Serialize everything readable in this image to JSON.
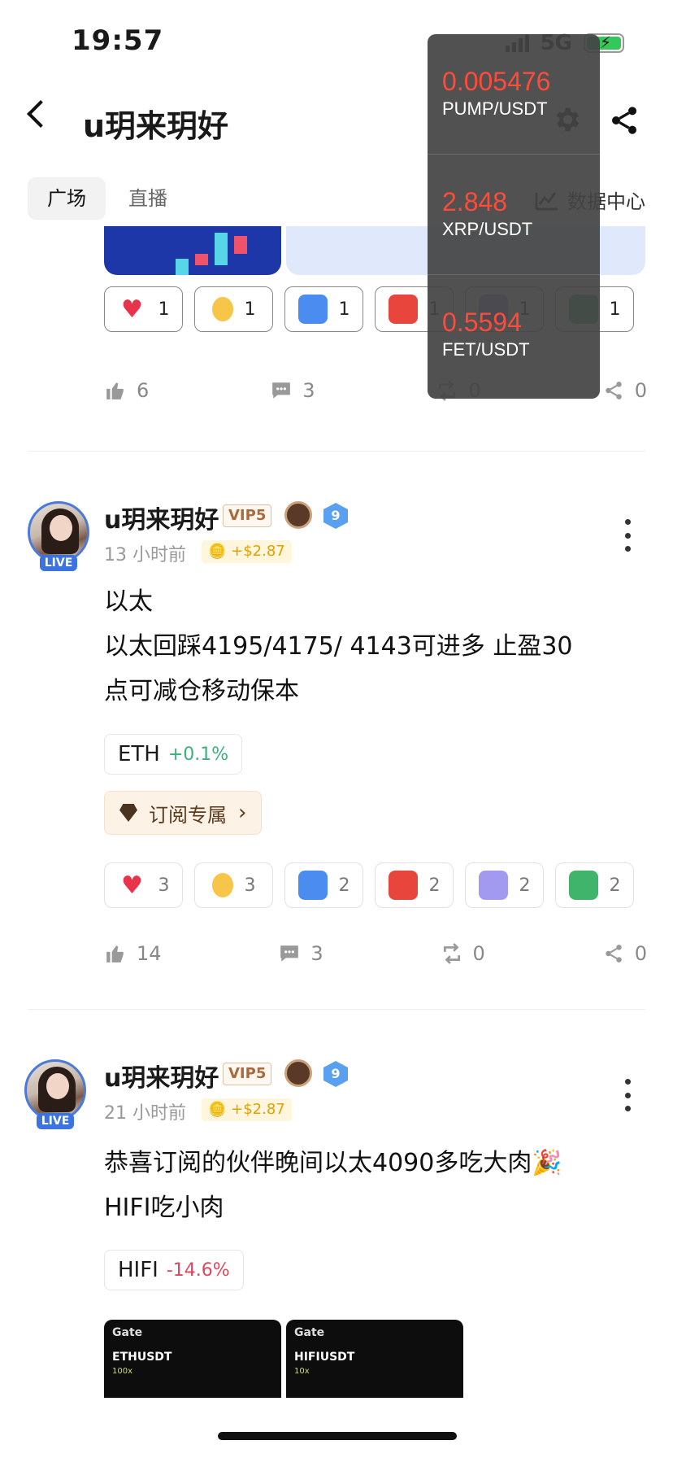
{
  "status_bar": {
    "time": "19:57",
    "network": "5G"
  },
  "header": {
    "title": "u玥来玥好"
  },
  "tabs": [
    {
      "label": "广场"
    },
    {
      "label": "直播"
    }
  ],
  "data_center": {
    "label": "数据中心"
  },
  "ticker": [
    {
      "price": "0.005476",
      "pair": "PUMP/USDT"
    },
    {
      "price": "2.848",
      "pair": "XRP/USDT"
    },
    {
      "price": "0.5594",
      "pair": "FET/USDT"
    }
  ],
  "post_top": {
    "reactions": [
      {
        "icon": "heart",
        "count": "1"
      },
      {
        "icon": "thumbs-up",
        "count": "1"
      },
      {
        "icon": "hodl",
        "count": "1"
      },
      {
        "icon": "angry",
        "count": "1"
      },
      {
        "icon": "scared",
        "count": "1"
      },
      {
        "icon": "sick",
        "count": "1"
      }
    ],
    "likes": "6",
    "comments": "3",
    "reposts": "0",
    "shares": "0"
  },
  "post1": {
    "author": "u玥来玥好",
    "vip": "VIP5",
    "level": "9",
    "live": "LIVE",
    "time": "13 小时前",
    "reward": "+$2.87",
    "text_line1": "以太",
    "text_line2": "以太回踩4195/4175/  4143可进多 止盈30",
    "text_line3": "点可减仓移动保本",
    "tag": {
      "symbol": "ETH",
      "change": "+0.1%"
    },
    "subscribe_label": "订阅专属",
    "reactions": [
      {
        "icon": "heart",
        "count": "3"
      },
      {
        "icon": "thumbs-up",
        "count": "3"
      },
      {
        "icon": "hodl",
        "count": "2"
      },
      {
        "icon": "angry",
        "count": "2"
      },
      {
        "icon": "scared",
        "count": "2"
      },
      {
        "icon": "sick",
        "count": "2"
      }
    ],
    "likes": "14",
    "comments": "3",
    "reposts": "0",
    "shares": "0"
  },
  "post2": {
    "author": "u玥来玥好",
    "vip": "VIP5",
    "level": "9",
    "live": "LIVE",
    "time": "21 小时前",
    "reward": "+$2.87",
    "text_line1": "恭喜订阅的伙伴晚间以太4090多吃大肉🎉",
    "text_line2": "HIFI吃小肉",
    "tag": {
      "symbol": "HIFI",
      "change": "-14.6%"
    },
    "images": [
      {
        "brand": "Gate",
        "pair": "ETHUSDT",
        "leverage": "100x"
      },
      {
        "brand": "Gate",
        "pair": "HIFIUSDT",
        "leverage": "10x"
      }
    ]
  },
  "colors": {
    "up": "#3bb07a",
    "down": "#e0455c",
    "ticker_price": "#ff4b3a",
    "accent": "#4a7bd8"
  }
}
